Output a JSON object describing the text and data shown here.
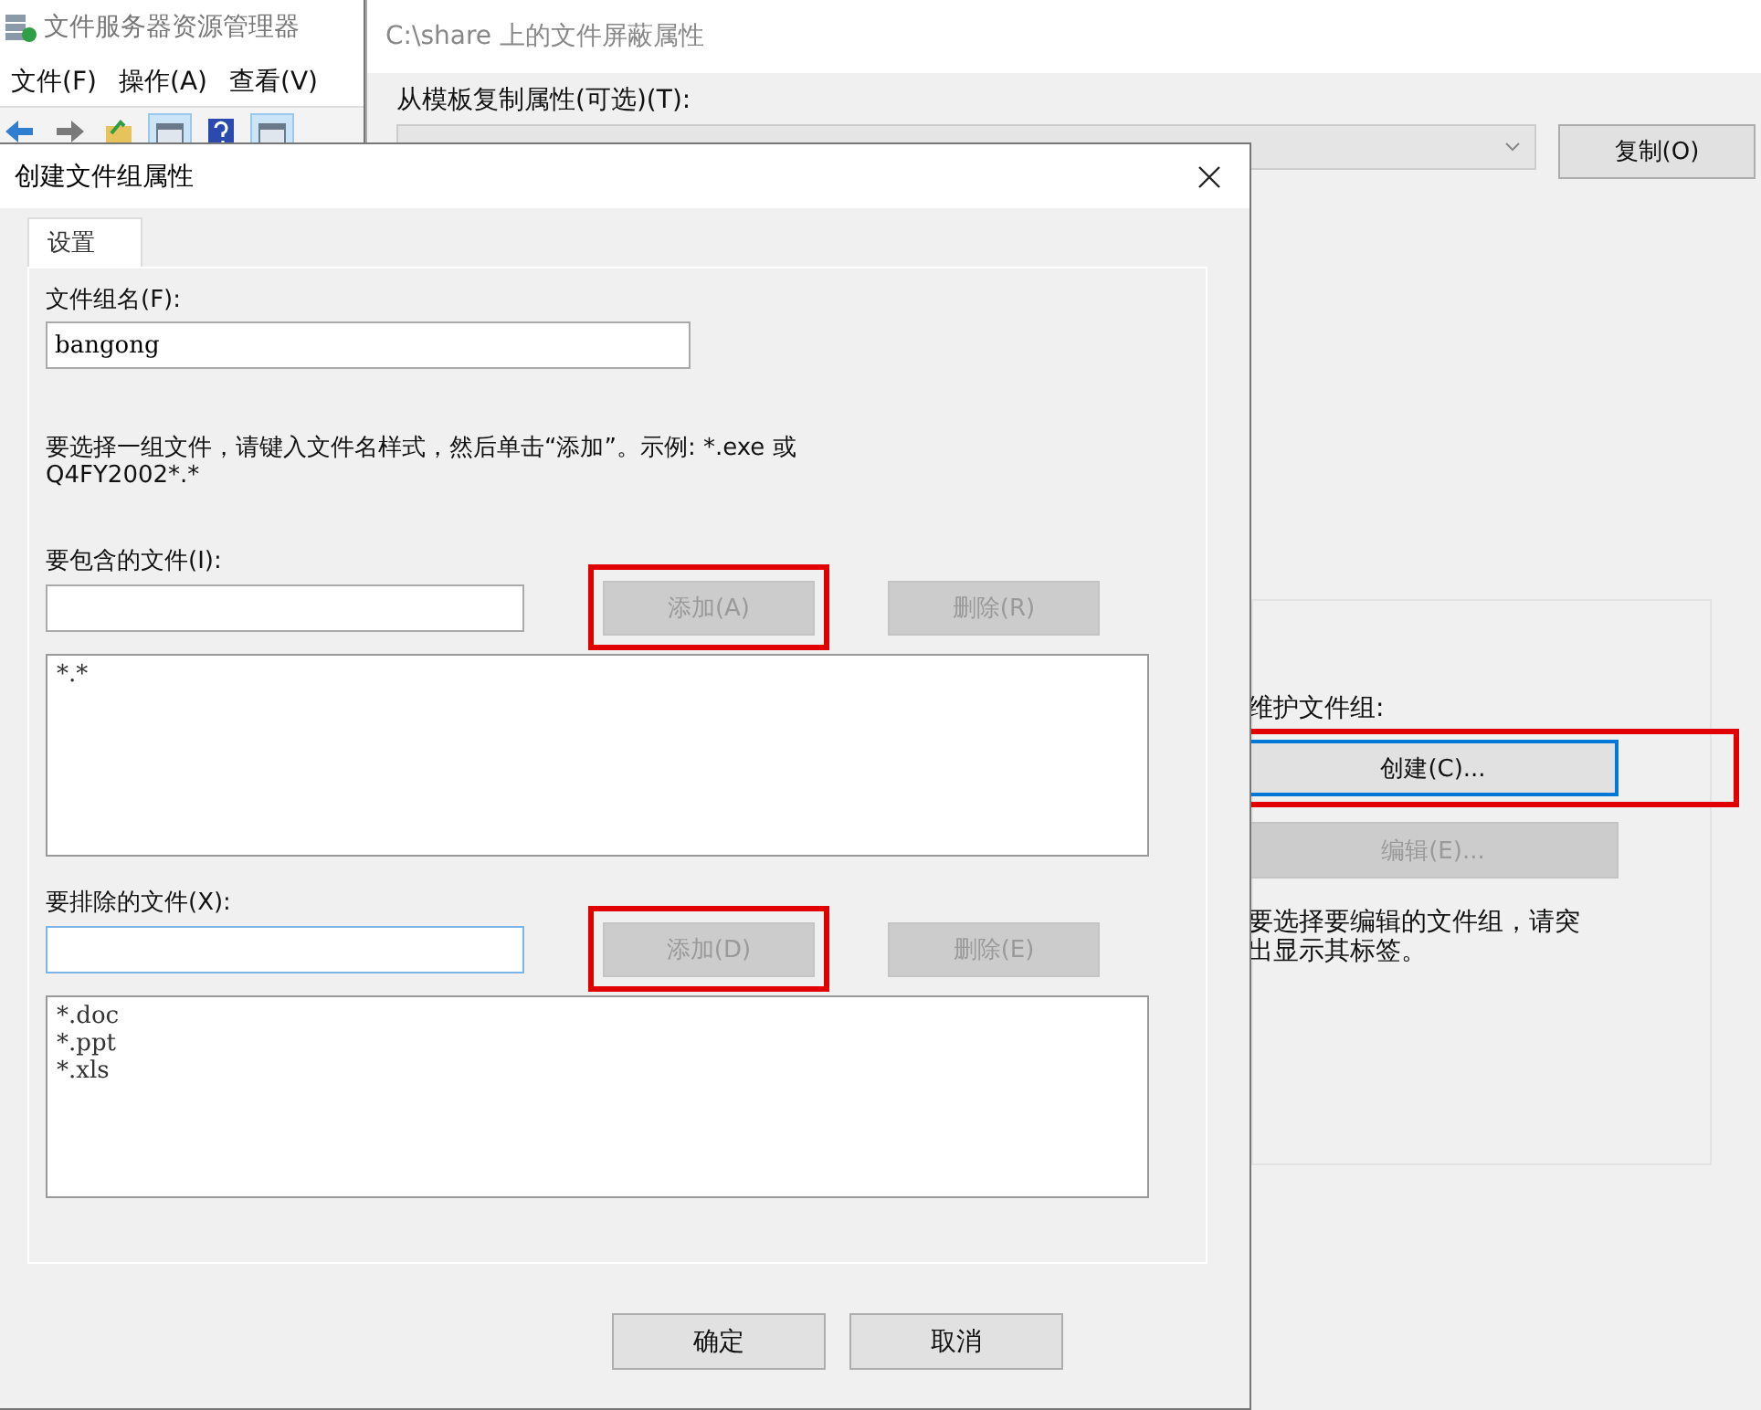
{
  "back_window": {
    "title": "文件服务器资源管理器",
    "menu": [
      {
        "label": "文件(F)"
      },
      {
        "label": "操作(A)"
      },
      {
        "label": "查看(V)"
      }
    ]
  },
  "properties_window": {
    "title": "C:\\share 上的文件屏蔽属性",
    "template_label": "从模板复制属性(可选)(T):",
    "copy_button": {
      "label": "复制(O)"
    },
    "group": {
      "label": "维护文件组:",
      "buttons": [
        {
          "label": "创建(C)...",
          "disabled": false,
          "focused": true,
          "highlighted": true
        },
        {
          "label": "编辑(E)...",
          "disabled": true,
          "focused": false,
          "highlighted": false
        }
      ],
      "hint": "要选择要编辑的文件组，请突出显示其标签。"
    }
  },
  "dialog": {
    "title": "创建文件组属性",
    "tabs": [
      {
        "label": "设置",
        "selected": true
      }
    ],
    "name_label": "文件组名(F):",
    "name_value": "bangong",
    "description": "要选择一组文件，请键入文件名样式，然后单击“添加”。示例: *.exe 或 Q4FY2002*.*",
    "sections": [
      {
        "label": "要包含的文件(I):",
        "input": {
          "focused": false
        },
        "buttons": [
          {
            "label": "添加(A)",
            "disabled": true,
            "highlighted": true
          },
          {
            "label": "删除(R)",
            "disabled": true,
            "highlighted": false
          }
        ],
        "items": [
          "*.*"
        ]
      },
      {
        "label": "要排除的文件(X):",
        "input": {
          "focused": true
        },
        "buttons": [
          {
            "label": "添加(D)",
            "disabled": true,
            "highlighted": true
          },
          {
            "label": "删除(E)",
            "disabled": true,
            "highlighted": false
          }
        ],
        "items": [
          "*.doc",
          "*.ppt",
          "*.xls"
        ]
      }
    ],
    "footer_buttons": [
      {
        "label": "确定"
      },
      {
        "label": "取消"
      }
    ]
  }
}
